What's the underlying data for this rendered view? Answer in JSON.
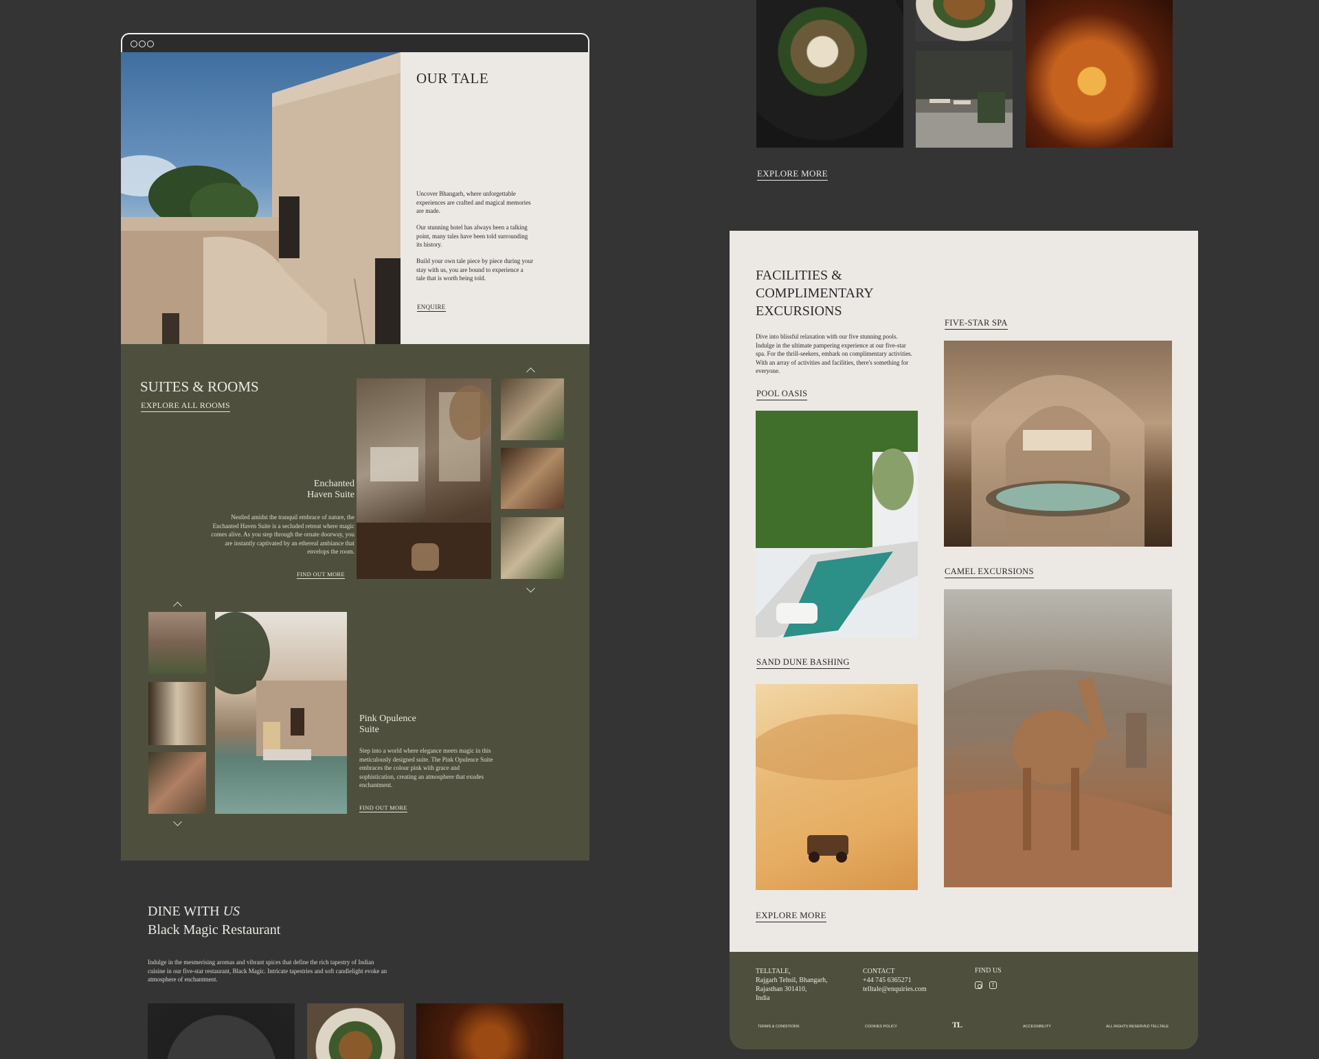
{
  "browser": {
    "dots": [
      "",
      "",
      ""
    ]
  },
  "our_tale": {
    "title": "OUR TALE",
    "paragraphs": [
      "Uncover Bhangarh, where unforgettable experiences are crafted and magical memories are made.",
      "Our stunning hotel has always been a talking point, many tales have been told surrounding its history.",
      "Build your own tale piece by piece during your stay with us, you are bound to experience a tale that is worth being told."
    ],
    "cta": "ENQUIRE"
  },
  "suites": {
    "title": "SUITES & ROOMS",
    "explore": "EXPLORE ALL ROOMS",
    "enchanted": {
      "name_line1": "Enchanted",
      "name_line2": "Haven Suite",
      "desc": "Nestled amidst the tranquil embrace of nature, the Enchanted Haven Suite is a secluded retreat where magic comes alive. As you step through the ornate doorway, you are instantly captivated by an ethereal ambiance that envelops the room.",
      "cta": "FIND OUT MORE"
    },
    "pink": {
      "name_line1": "Pink Opulence",
      "name_line2": "Suite",
      "desc": "Step into a world where elegance meets magic in this meticulously designed suite. The Pink Opulence Suite embraces the colour pink with grace and sophistication, creating an atmosphere that exudes enchantment.",
      "cta": "FIND OUT MORE"
    }
  },
  "dine": {
    "title_prefix": "DINE WITH ",
    "title_em": "US",
    "subtitle": "Black Magic Restaurant",
    "desc": "Indulge in the mesmerising aromas and vibrant spices that define the rich tapestry of Indian cuisine in our five-star restaurant, Black Magic. Intricate tapestries and soft candlelight evoke an atmosphere of enchantment.",
    "explore": "EXPLORE MORE"
  },
  "facilities": {
    "title_line1": "FACILITIES &",
    "title_line2": "COMPLIMENTARY",
    "title_line3": "EXCURSIONS",
    "desc": "Dive into blissful relaxation with our five stunning pools. Indulge in the ultimate pampering experience at our five-star spa. For the thrill-seekers, embark on complimentary activities. With an array of activities and facilities, there's something for everyone.",
    "pool": "POOL OASIS",
    "spa": "FIVE-STAR SPA",
    "dune": "SAND DUNE BASHING",
    "camel": "CAMEL EXCURSIONS",
    "explore": "EXPLORE MORE"
  },
  "footer": {
    "address": [
      "TELLTALE,",
      "Rajgarh Tehsil, Bhangarh,",
      "Rajasthan 301410,",
      "India"
    ],
    "contact_title": "CONTACT",
    "phone": "+44 745 6365271",
    "email": "telltale@enquiries.com",
    "find_title": "FIND US",
    "logo": "TL",
    "links": [
      "TERMS & CONDITIONS",
      "COOKIES POLICY",
      "ACCESSIBILITY",
      "ALL RIGHTS RESERVED TELLTALE"
    ]
  },
  "colors": {
    "olive": "#4e503d",
    "cream": "#ece9e5",
    "dark": "#343434"
  }
}
